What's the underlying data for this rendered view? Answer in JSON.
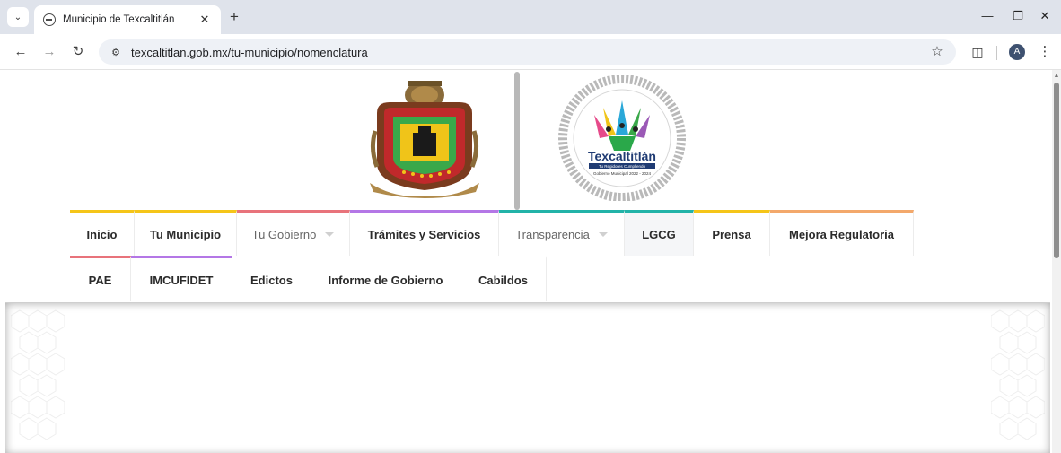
{
  "browser": {
    "tab_title": "Municipio de Texcaltitlán",
    "url": "texcaltitlan.gob.mx/tu-municipio/nomenclatura",
    "profile_initial": "A",
    "icons": {
      "tab_search": "chevron-down-icon",
      "favicon": "globe-icon",
      "tab_close": "close-icon",
      "new_tab": "plus-icon",
      "minimize": "minimize-icon",
      "restore": "restore-icon",
      "close": "close-icon",
      "back": "arrow-left-icon",
      "forward": "arrow-right-icon",
      "reload": "reload-icon",
      "site_info": "tune-icon",
      "bookmark": "star-icon",
      "extensions": "puzzle-icon",
      "menu": "more-vert-icon"
    }
  },
  "header": {
    "gov_logo": {
      "name": "Texcaltitlán",
      "slogan": "Tu Regidores Cumpliendo",
      "period": "Gobierno Municipal 2022 - 2024"
    }
  },
  "menu": {
    "row1": [
      {
        "label": "Inicio",
        "accent": "#f5c518",
        "dropdown": false,
        "light": false,
        "shaded": false
      },
      {
        "label": "Tu Municipio",
        "accent": "#f5c518",
        "dropdown": false,
        "light": false,
        "shaded": false
      },
      {
        "label": "Tu Gobierno",
        "accent": "#e8737b",
        "dropdown": true,
        "light": true,
        "shaded": false
      },
      {
        "label": "Trámites y Servicios",
        "accent": "#b477e6",
        "dropdown": false,
        "light": false,
        "shaded": false
      },
      {
        "label": "Transparencia",
        "accent": "#22b3a8",
        "dropdown": true,
        "light": true,
        "shaded": false
      },
      {
        "label": "LGCG",
        "accent": "#22b3a8",
        "dropdown": false,
        "light": false,
        "shaded": true
      },
      {
        "label": "Prensa",
        "accent": "#f5c518",
        "dropdown": false,
        "light": false,
        "shaded": false
      },
      {
        "label": "Mejora Regulatoria",
        "accent": "#f3a86b",
        "dropdown": false,
        "light": false,
        "shaded": false
      }
    ],
    "row2": [
      {
        "label": "PAE",
        "accent": "#e8737b",
        "dropdown": false,
        "light": false,
        "shaded": false
      },
      {
        "label": "IMCUFIDET",
        "accent": "#b477e6",
        "dropdown": false,
        "light": false,
        "shaded": false
      },
      {
        "label": "Edictos",
        "accent": "",
        "dropdown": false,
        "light": false,
        "shaded": false
      },
      {
        "label": "Informe de Gobierno",
        "accent": "",
        "dropdown": false,
        "light": false,
        "shaded": false
      },
      {
        "label": "Cabildos",
        "accent": "",
        "dropdown": false,
        "light": false,
        "shaded": false
      }
    ]
  }
}
